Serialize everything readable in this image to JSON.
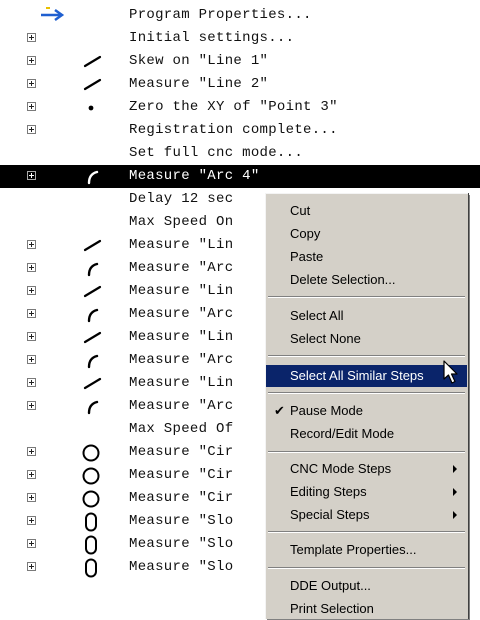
{
  "steps": [
    {
      "icon": "blue-arrow-icon",
      "expandable": false,
      "text": "Program Properties..."
    },
    {
      "icon": "",
      "expandable": true,
      "text": "Initial settings..."
    },
    {
      "icon": "line-icon",
      "expandable": true,
      "text": "Skew on \"Line 1\""
    },
    {
      "icon": "line-icon",
      "expandable": true,
      "text": "Measure \"Line 2\""
    },
    {
      "icon": "point-icon",
      "expandable": true,
      "text": "Zero the XY of \"Point 3\""
    },
    {
      "icon": "",
      "expandable": true,
      "text": "Registration complete..."
    },
    {
      "icon": "",
      "expandable": false,
      "text": "Set full cnc mode..."
    },
    {
      "icon": "arc-icon",
      "expandable": true,
      "text": "Measure \"Arc 4\"",
      "selected": true
    },
    {
      "icon": "",
      "expandable": false,
      "text": "Delay 12 sec"
    },
    {
      "icon": "",
      "expandable": false,
      "text": "Max Speed On"
    },
    {
      "icon": "line-icon",
      "expandable": true,
      "text": "Measure \"Lin"
    },
    {
      "icon": "arc-icon",
      "expandable": true,
      "text": "Measure \"Arc"
    },
    {
      "icon": "line-icon",
      "expandable": true,
      "text": "Measure \"Lin"
    },
    {
      "icon": "arc-icon",
      "expandable": true,
      "text": "Measure \"Arc"
    },
    {
      "icon": "line-icon",
      "expandable": true,
      "text": "Measure \"Lin"
    },
    {
      "icon": "arc-icon",
      "expandable": true,
      "text": "Measure \"Arc"
    },
    {
      "icon": "line-icon",
      "expandable": true,
      "text": "Measure \"Lin"
    },
    {
      "icon": "arc-icon",
      "expandable": true,
      "text": "Measure \"Arc"
    },
    {
      "icon": "",
      "expandable": false,
      "text": "Max Speed Of"
    },
    {
      "icon": "circle-icon",
      "expandable": true,
      "text": "Measure \"Cir"
    },
    {
      "icon": "circle-icon",
      "expandable": true,
      "text": "Measure \"Cir"
    },
    {
      "icon": "circle-icon",
      "expandable": true,
      "text": "Measure \"Cir"
    },
    {
      "icon": "slot-icon",
      "expandable": true,
      "text": "Measure \"Slo"
    },
    {
      "icon": "slot-icon",
      "expandable": true,
      "text": "Measure \"Slo"
    },
    {
      "icon": "slot-icon",
      "expandable": true,
      "text": "Measure \"Slo"
    }
  ],
  "context_menu": {
    "cut": "Cut",
    "copy": "Copy",
    "paste": "Paste",
    "delete_selection": "Delete Selection...",
    "select_all": "Select All",
    "select_none": "Select None",
    "select_all_similar": "Select All Similar Steps",
    "pause_mode": "Pause Mode",
    "record_edit_mode": "Record/Edit Mode",
    "cnc_mode_steps": "CNC Mode Steps",
    "editing_steps": "Editing Steps",
    "special_steps": "Special Steps",
    "template_properties": "Template Properties...",
    "dde_output": "DDE Output...",
    "print_selection": "Print Selection"
  },
  "colors": {
    "selection_bg": "#000000",
    "menu_highlight": "#0a246a",
    "menu_bg": "#d4d0c8",
    "arrow_blue": "#1f5fd0"
  }
}
